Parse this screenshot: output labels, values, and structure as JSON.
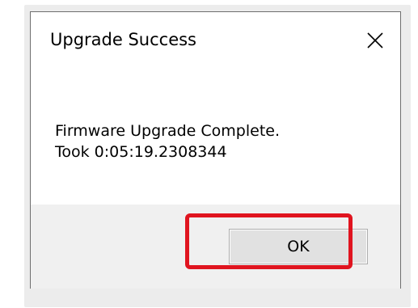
{
  "dialog": {
    "title": "Upgrade Success",
    "close_icon": "close-x-icon",
    "message_lines": [
      "Firmware Upgrade Complete.",
      "Took 0:05:19.2308344"
    ],
    "ok_label": "OK"
  },
  "colors": {
    "highlight": "#e0141f",
    "footer_bg": "#f0f0f0",
    "button_bg": "#e1e1e1",
    "border": "#6f6f6f"
  }
}
